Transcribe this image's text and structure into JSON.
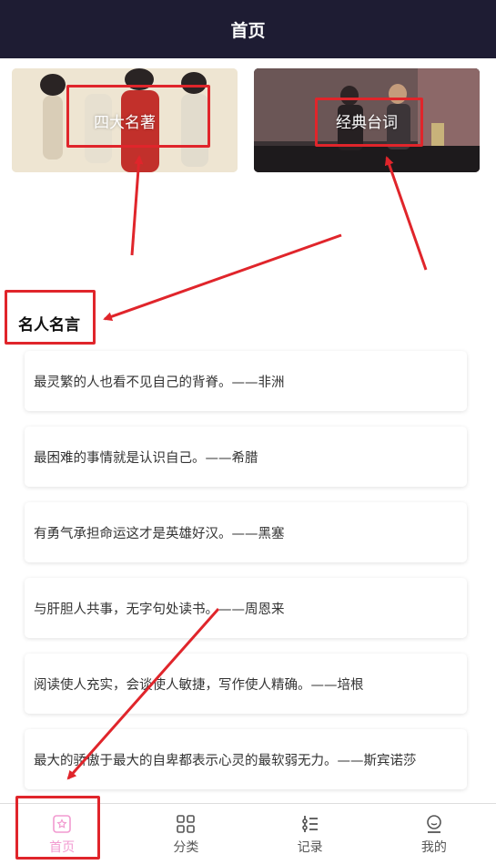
{
  "header": {
    "title": "首页"
  },
  "banners": [
    {
      "label": "四大名著"
    },
    {
      "label": "经典台词"
    }
  ],
  "section": {
    "title": "名人名言"
  },
  "quotes": [
    "最灵繁的人也看不见自己的背脊。——非洲",
    "最困难的事情就是认识自己。——希腊",
    "有勇气承担命运这才是英雄好汉。——黑塞",
    "与肝胆人共事，无字句处读书。——周恩来",
    "阅读使人充实，会谈使人敏捷，写作使人精确。——培根",
    "最大的骄傲于最大的自卑都表示心灵的最软弱无力。——斯宾诺莎"
  ],
  "tabbar": {
    "items": [
      {
        "label": "首页",
        "icon": "home-star-icon",
        "active": true
      },
      {
        "label": "分类",
        "icon": "grid-icon",
        "active": false
      },
      {
        "label": "记录",
        "icon": "list-record-icon",
        "active": false
      },
      {
        "label": "我的",
        "icon": "user-icon",
        "active": false
      }
    ]
  },
  "colors": {
    "header_bg": "#1e1c33",
    "active_tab": "#f29ad0",
    "annotation": "#e0252b"
  }
}
